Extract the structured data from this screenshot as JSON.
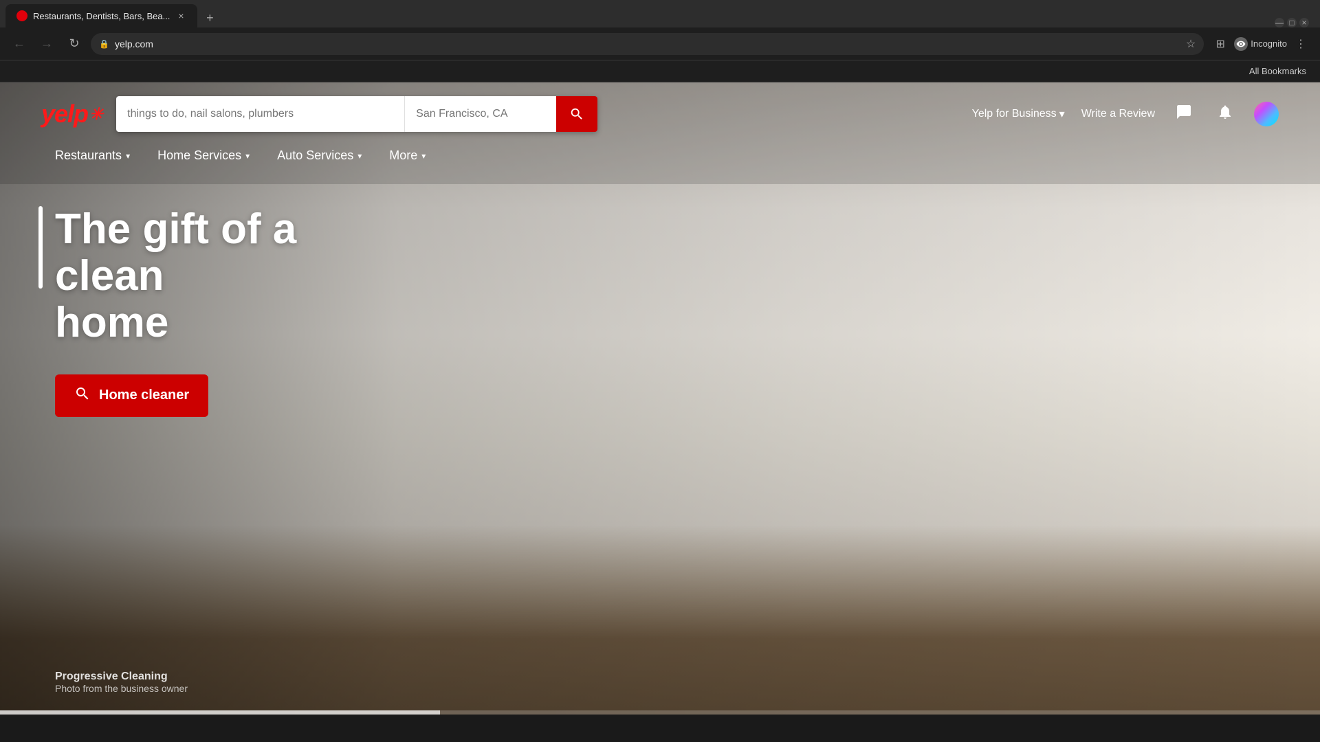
{
  "browser": {
    "tab": {
      "title": "Restaurants, Dentists, Bars, Bea...",
      "favicon_label": "yelp-favicon"
    },
    "addressbar": {
      "url": "yelp.com",
      "lock_label": "secure"
    },
    "incognito_label": "Incognito",
    "bookmarks_bar_label": "All Bookmarks"
  },
  "yelp": {
    "logo_text": "yelp",
    "logo_burst": "✳",
    "search": {
      "find_placeholder": "things to do, nail salons, plumbers",
      "near_placeholder": "San Francisco, CA",
      "button_label": "🔍"
    },
    "header_right": {
      "business_link": "Yelp for Business",
      "review_link": "Write a Review"
    },
    "nav": {
      "items": [
        {
          "label": "Restaurants",
          "has_dropdown": true
        },
        {
          "label": "Home Services",
          "has_dropdown": true
        },
        {
          "label": "Auto Services",
          "has_dropdown": true
        },
        {
          "label": "More",
          "has_dropdown": true
        }
      ]
    },
    "hero": {
      "title_line1": "The gift of a clean",
      "title_line2": "home",
      "cta_button": "Home cleaner"
    },
    "photo_credit": {
      "business": "Progressive Cleaning",
      "subtitle": "Photo from the business owner"
    }
  },
  "icons": {
    "back": "←",
    "forward": "→",
    "reload": "↻",
    "bookmark_star": "☆",
    "extensions": "⊞",
    "menu": "⋮",
    "search": "🔍",
    "lock": "🔒",
    "close": "×",
    "new_tab": "+",
    "chevron_down": "▾",
    "bell": "🔔",
    "messages": "💬",
    "minimize": "—",
    "maximize": "□"
  }
}
